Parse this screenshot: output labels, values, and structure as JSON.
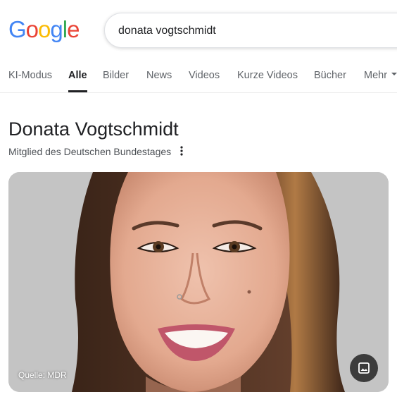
{
  "logo": {
    "letters": [
      "G",
      "o",
      "o",
      "g",
      "l",
      "e"
    ],
    "colors": [
      "#4285F4",
      "#EA4335",
      "#FBBC05",
      "#4285F4",
      "#34A853",
      "#EA4335"
    ]
  },
  "search": {
    "query": "donata vogtschmidt"
  },
  "tabs": [
    {
      "label": "KI-Modus"
    },
    {
      "label": "Alle"
    },
    {
      "label": "Bilder"
    },
    {
      "label": "News"
    },
    {
      "label": "Videos"
    },
    {
      "label": "Kurze Videos"
    },
    {
      "label": "Bücher"
    },
    {
      "label": "Mehr"
    }
  ],
  "active_tab": "Alle",
  "knowledge_panel": {
    "title": "Donata Vogtschmidt",
    "subtitle": "Mitglied des Deutschen Bundestages",
    "more_icon": "more-vert-icon",
    "image_source": "Quelle: MDR",
    "image_button_icon": "image-icon"
  },
  "colors": {
    "text_primary": "#202124",
    "text_secondary": "#5f6368",
    "photo_background": "#c7c7c7"
  }
}
